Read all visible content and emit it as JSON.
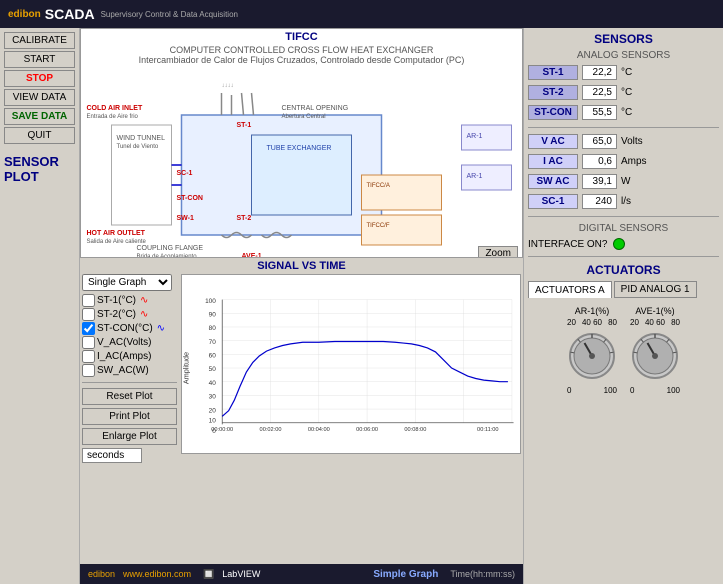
{
  "header": {
    "edibon": "edibon",
    "scada": "SCADA",
    "subtitle": "Supervisory Control & Data Acquisition"
  },
  "sidebar": {
    "buttons": [
      {
        "label": "CALIBRATE",
        "style": "normal"
      },
      {
        "label": "START",
        "style": "normal"
      },
      {
        "label": "STOP",
        "style": "stop"
      },
      {
        "label": "VIEW DATA",
        "style": "normal"
      },
      {
        "label": "SAVE DATA",
        "style": "save-data"
      },
      {
        "label": "QUIT",
        "style": "normal"
      }
    ],
    "sensor_plot_label": "SENSOR PLOT"
  },
  "diagram": {
    "title": "TIFCC",
    "subtitle1": "COMPUTER CONTROLLED CROSS FLOW HEAT EXCHANGER",
    "subtitle2": "Intercambiador de Calor de Flujos Cruzados, Controlado desde Computador (PC)",
    "zoom_label": "Zoom"
  },
  "chart": {
    "signal_title": "SIGNAL VS TIME",
    "graph_type": "Single Graph",
    "sensors": [
      {
        "label": "ST-1(°C)",
        "checked": false
      },
      {
        "label": "ST-2(°C)",
        "checked": false
      },
      {
        "label": "ST-CON(°C)",
        "checked": true
      },
      {
        "label": "V_AC(Volts)",
        "checked": false
      },
      {
        "label": "I_AC(Amps)",
        "checked": false
      },
      {
        "label": "SW_AC(W)",
        "checked": false
      }
    ],
    "buttons": [
      {
        "label": "Reset Plot"
      },
      {
        "label": "Print Plot"
      },
      {
        "label": "Enlarge Plot"
      }
    ],
    "seconds_label": "seconds",
    "y_axis_label": "Amplitude",
    "y_ticks": [
      0,
      10,
      20,
      30,
      40,
      50,
      60,
      70,
      80,
      90,
      100
    ],
    "x_ticks": [
      "00:00:00",
      "00:02:00",
      "00:04:00",
      "00:06:00",
      "00:08:00",
      "00:11:00"
    ],
    "time_label": "Time(hh:mm:ss)",
    "simple_graph_label": "Simple Graph"
  },
  "footer": {
    "website": "www.edibon.com",
    "labview": "LabVIEW"
  },
  "sensors": {
    "title": "SENSORS",
    "subtitle": "ANALOG SENSORS",
    "rows": [
      {
        "label": "ST-1",
        "value": "22,2",
        "unit": "°C"
      },
      {
        "label": "ST-2",
        "value": "22,5",
        "unit": "°C"
      },
      {
        "label": "ST-CON",
        "value": "55,5",
        "unit": "°C"
      },
      {
        "label": "V AC",
        "value": "65,0",
        "unit": "Volts"
      },
      {
        "label": "I AC",
        "value": "0,6",
        "unit": "Amps"
      },
      {
        "label": "SW AC",
        "value": "39,1",
        "unit": "W"
      },
      {
        "label": "SC-1",
        "value": "240",
        "unit": "l/s"
      }
    ],
    "digital_title": "DIGITAL SENSORS",
    "interface_label": "INTERFACE ON?"
  },
  "actuators": {
    "title": "ACTUATORS",
    "tabs": [
      {
        "label": "ACTUATORS A",
        "active": true
      },
      {
        "label": "PID ANALOG 1",
        "active": false
      }
    ],
    "knobs": [
      {
        "label": "AR-1(%)",
        "min": "0",
        "max": "100",
        "mid": "40 60",
        "value": 40
      },
      {
        "label": "AVE-1(%)",
        "min": "0",
        "max": "100",
        "mid": "40 60",
        "value": 40
      }
    ]
  }
}
